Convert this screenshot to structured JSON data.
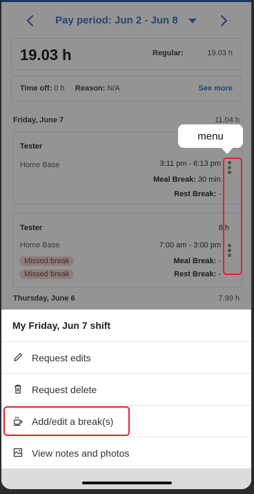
{
  "header": {
    "pay_period": "Pay period: Jun 2 - Jun 8"
  },
  "summary": {
    "total_hours": "19.03 h",
    "regular_label": "Regular:",
    "regular_value": "19.03 h"
  },
  "time_off": {
    "label": "Time off:",
    "value": "0 h",
    "reason_label": "Reason:",
    "reason_value": "N/A",
    "see_more": "See more"
  },
  "days": [
    {
      "date": "Friday, June 7",
      "hours": "11.04 h",
      "shifts": [
        {
          "role": "Tester",
          "location": "Home Base",
          "time": "3:11 pm - 6:13 pm",
          "meal_break_label": "Meal Break:",
          "meal_break_value": "30 min",
          "rest_break_label": "Rest Break:",
          "rest_break_value": "-"
        },
        {
          "role": "Tester",
          "hours": "8 h",
          "location": "Home Base",
          "time": "7:00 am - 3:00 pm",
          "badges": [
            "Missed break",
            "Missed break"
          ],
          "meal_break_label": "Meal Break:",
          "meal_break_value": "-",
          "rest_break_label": "Rest Break:",
          "rest_break_value": "-"
        }
      ]
    },
    {
      "date": "Thursday, June 6",
      "hours": "7.99 h"
    }
  ],
  "annotation": {
    "menu_label": "menu"
  },
  "sheet": {
    "title": "My Friday, Jun 7 shift",
    "items": [
      {
        "label": "Request edits",
        "icon": "pencil-icon"
      },
      {
        "label": "Request delete",
        "icon": "trash-icon"
      },
      {
        "label": "Add/edit a break(s)",
        "icon": "coffee-cup-icon"
      },
      {
        "label": "View notes and photos",
        "icon": "notes-photo-icon"
      }
    ]
  },
  "colors": {
    "accent": "#3f79c8",
    "highlight": "#e2202a",
    "badge_bg": "#f1d7d4"
  }
}
